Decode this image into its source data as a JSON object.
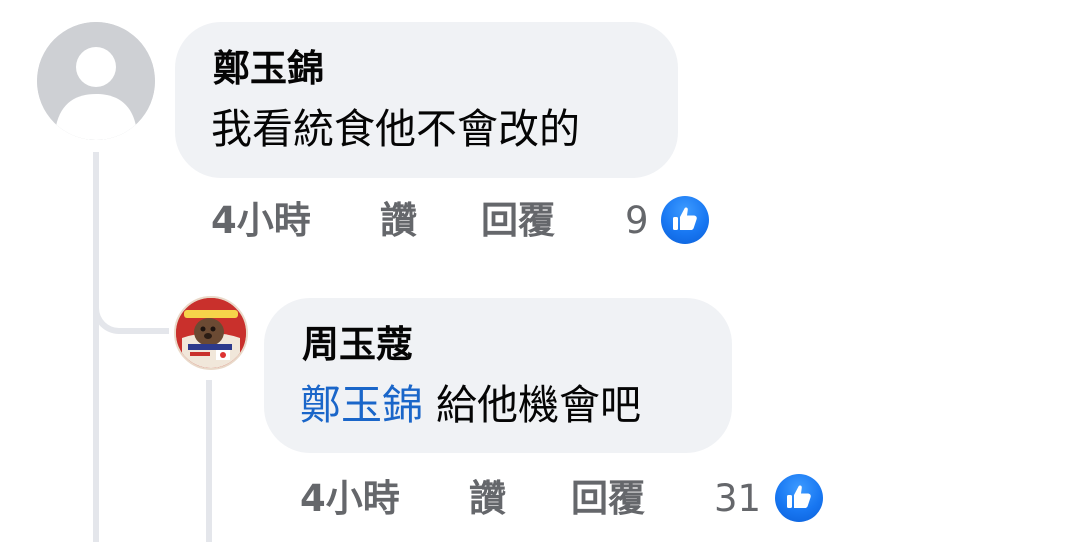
{
  "comments": [
    {
      "author": "鄭玉錦",
      "text": "我看統食他不會改的",
      "time": "4小時",
      "like_label": "讚",
      "reply_label": "回覆",
      "reaction_count": "9",
      "reaction_icon": "thumbs-up-icon",
      "avatar_icon": "default-profile-silhouette"
    },
    {
      "author": "周玉蔻",
      "mention": "鄭玉錦",
      "text": "給他機會吧",
      "time": "4小時",
      "like_label": "讚",
      "reply_label": "回覆",
      "reaction_count": "31",
      "reaction_icon": "thumbs-up-icon",
      "avatar_icon": "profile-photo"
    }
  ],
  "colors": {
    "bubble_bg": "#f0f2f5",
    "text_primary": "#050505",
    "text_secondary": "#65676b",
    "mention_link": "#1a66c9",
    "reaction_blue": "#1877f2",
    "thread_line": "#e4e6eb"
  }
}
